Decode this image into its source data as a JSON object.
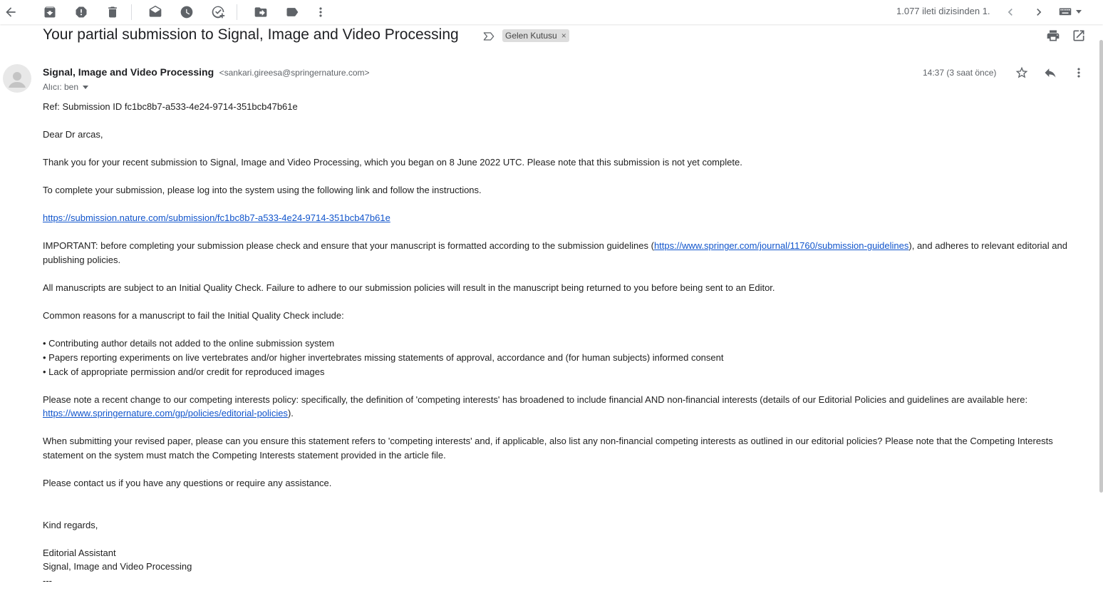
{
  "toolbar": {
    "back_icon": "arrow-left-icon",
    "archive_icon": "archive-icon",
    "spam_icon": "report-spam-icon",
    "delete_icon": "trash-icon",
    "mark_unread_icon": "mark-unread-icon",
    "snooze_icon": "clock-icon",
    "add_task_icon": "add-task-icon",
    "move_icon": "move-to-icon",
    "label_icon": "label-icon",
    "more_icon": "more-vert-icon",
    "counter": "1.077 ileti dizisinden 1.",
    "keyboard_icon": "keyboard-icon"
  },
  "email": {
    "subject": "Your partial submission to Signal, Image and Video Processing",
    "label": "Gelen Kutusu",
    "label_remove": "×",
    "sender_name": "Signal, Image and Video Processing",
    "sender_email": "<sankari.gireesa@springernature.com>",
    "recipient": "Alıcı: ben",
    "timestamp": "14:37 (3 saat önce)"
  },
  "body": {
    "ref": "Ref: Submission ID fc1bc8b7-a533-4e24-9714-351bcb47b61e",
    "greeting": "Dear Dr arcas,",
    "p1": "Thank you for your recent submission to Signal, Image and Video Processing, which you began on 8 June 2022 UTC. Please note that this submission is not yet complete.",
    "p2": "To complete your submission, please log into the system using the following link and follow the instructions.",
    "link1": "https://submission.nature.com/submission/fc1bc8b7-a533-4e24-9714-351bcb47b61e",
    "important_pre": "IMPORTANT: before completing your submission please check and ensure that your manuscript is formatted according to the submission guidelines (",
    "important_link": "https://www.springer.com/journal/11760/submission-guidelines",
    "important_post": "), and adheres to relevant editorial and publishing policies.",
    "p3": "All manuscripts are subject to an Initial Quality Check. Failure to adhere to our submission policies will result in the manuscript being returned to you before being sent to an Editor.",
    "p4": "Common reasons for a manuscript to fail the Initial Quality Check include:",
    "bullets": [
      "• Contributing author details not added to the online submission system",
      "• Papers reporting experiments on live vertebrates and/or higher invertebrates missing statements of approval, accordance and (for human subjects) informed consent",
      "• Lack of appropriate permission and/or credit for reproduced images"
    ],
    "p5_pre": "Please note a recent change to our competing interests policy: specifically, the definition of 'competing interests' has broadened to include financial AND non-financial interests (details of our Editorial Policies and guidelines are available here: ",
    "p5_link": "https://www.springernature.com/gp/policies/editorial-policies",
    "p5_post": ").",
    "p6": "When submitting your revised paper, please can you ensure this statement refers to 'competing interests' and, if applicable, also list any non-financial competing interests as outlined in our editorial policies? Please note that the Competing Interests statement on the system must match the Competing Interests statement provided in the article file.",
    "p7": "Please contact us if you have any questions or require any assistance.",
    "closing": "Kind regards,",
    "sig1": "Editorial Assistant",
    "sig2": "Signal, Image and Video Processing",
    "sig3": "---"
  }
}
